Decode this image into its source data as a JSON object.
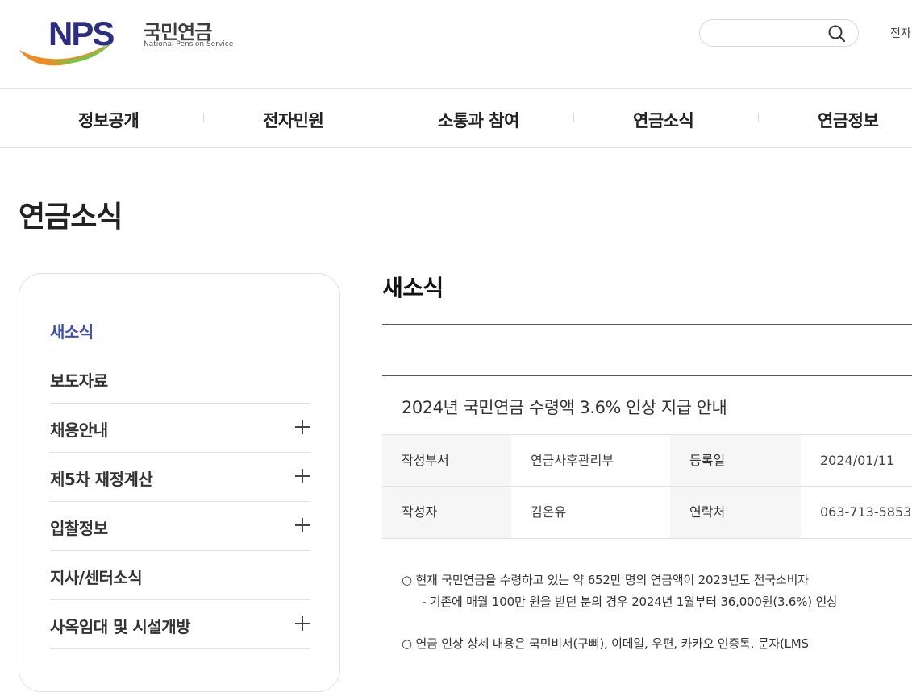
{
  "header": {
    "logo_text": "NPS",
    "logo_korean": "국민연금",
    "logo_english": "National Pension Service",
    "search_placeholder": "",
    "util_link": "전자"
  },
  "gnb": [
    "정보공개",
    "전자민원",
    "소통과 참여",
    "연금소식",
    "연금정보"
  ],
  "page_title": "연금소식",
  "lnb": {
    "items": [
      {
        "label": "새소식",
        "active": true,
        "expandable": false
      },
      {
        "label": "보도자료",
        "active": false,
        "expandable": false
      },
      {
        "label": "채용안내",
        "active": false,
        "expandable": true
      },
      {
        "label": "제5차 재정계산",
        "active": false,
        "expandable": true
      },
      {
        "label": "입찰정보",
        "active": false,
        "expandable": true
      },
      {
        "label": "지사/센터소식",
        "active": false,
        "expandable": false
      },
      {
        "label": "사옥임대 및 시설개방",
        "active": false,
        "expandable": true
      }
    ]
  },
  "content": {
    "section_title": "새소식",
    "post_title": "2024년 국민연금 수령액 3.6% 인상 지급 안내",
    "meta": {
      "dept_label": "작성부서",
      "dept_value": "연금사후관리부",
      "date_label": "등록일",
      "date_value": "2024/01/11",
      "author_label": "작성자",
      "author_value": "김온유",
      "contact_label": "연락처",
      "contact_value": "063-713-5853"
    },
    "body": [
      "○ 현재 국민연금을 수령하고 있는 약 652만 명의 연금액이 2023년도 전국소비자",
      "- 기존에 매월 100만 원을 받던 분의 경우 2024년 1월부터 36,000원(3.6%) 인상",
      "○ 연금 인상 상세 내용은 국민비서(구삐), 이메일, 우편, 카카오 인증톡, 문자(LMS"
    ]
  },
  "colors": {
    "active": "#3d4fb0",
    "logo_navy": "#2b2e83",
    "logo_green": "#7cc242",
    "logo_orange": "#f08a24"
  }
}
